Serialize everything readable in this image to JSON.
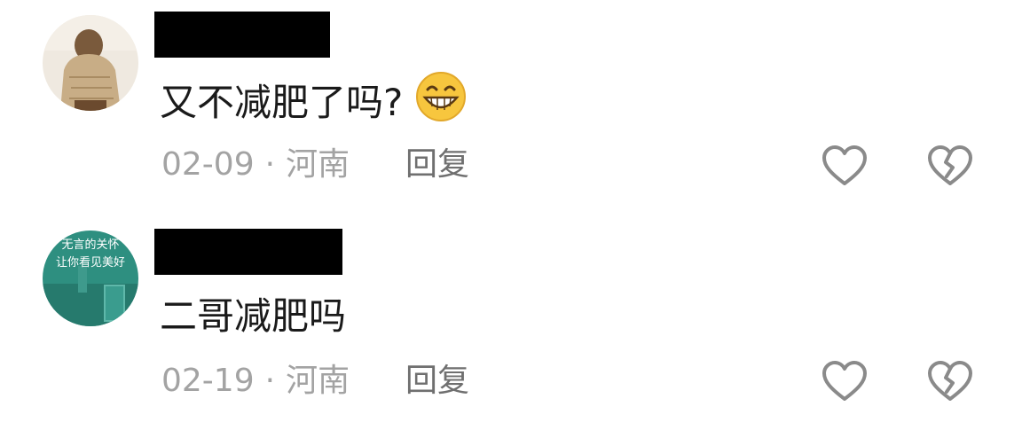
{
  "comments": [
    {
      "text": "又不减肥了吗?",
      "emoji": "grinning-face-emoji",
      "date": "02-09",
      "separator": "·",
      "location": "河南",
      "reply_label": "回复"
    },
    {
      "text": "二哥减肥吗",
      "avatar_text_line1": "无言的关怀",
      "avatar_text_line2": "让你看见美好",
      "date": "02-19",
      "separator": "·",
      "location": "河南",
      "reply_label": "回复"
    }
  ],
  "icons": {
    "like": "heart-icon",
    "dislike": "broken-heart-icon"
  },
  "colors": {
    "text": "#1a1a1a",
    "meta": "#a3a3a3",
    "reply": "#6f6f6f",
    "icon": "#8a8a8a",
    "avatar2_bg": "#2e8f80"
  }
}
